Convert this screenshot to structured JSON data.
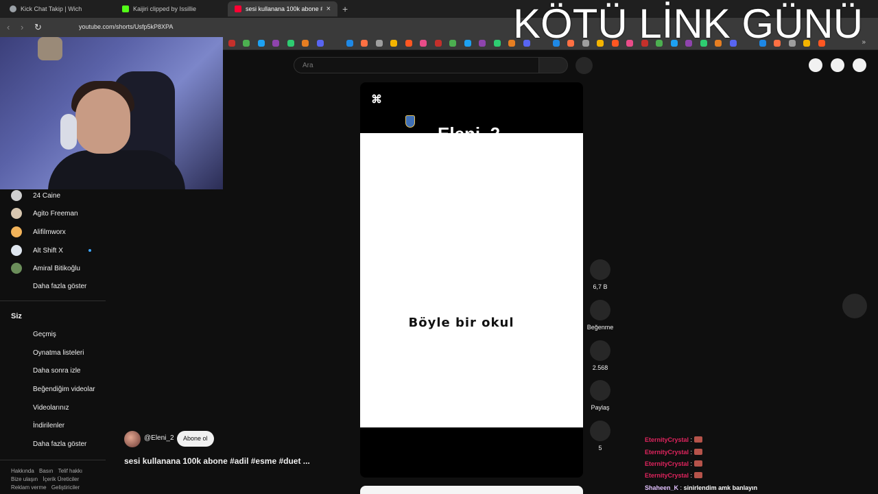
{
  "browser": {
    "tabs": [
      {
        "label": "Kick Chat Takip | Wich",
        "favicon_color": "#9aa0a6"
      },
      {
        "label": "Kaijiri clipped by Issillie",
        "favicon_color": "#53fc18"
      },
      {
        "label": "sesi kullanana 100k abone #adil",
        "favicon_color": "#ff0033"
      }
    ],
    "new_tab": "+",
    "close": "×",
    "url": "youtube.com/shorts/Usfp5kP8XPA",
    "back": "‹",
    "forward": "›",
    "reload": "↻",
    "bookmarks_more": "»"
  },
  "overlay": {
    "title": "KÖTÜ LİNK GÜNÜ"
  },
  "search": {
    "placeholder": "Ara"
  },
  "sidebar": {
    "subscriptions": [
      {
        "name": "24 Caine",
        "avatar_color": "#cfcfcf"
      },
      {
        "name": "Agito Freeman",
        "avatar_color": "#d8c7b0"
      },
      {
        "name": "Alifilmworx",
        "avatar_color": "#f2b35a"
      },
      {
        "name": "Alt Shift X",
        "avatar_color": "#dfe6ef",
        "new": true
      },
      {
        "name": "Amiral Bitikoğlu",
        "avatar_color": "#6b8e5a"
      }
    ],
    "subs_more": "Daha fazla göster",
    "you_heading": "Siz",
    "you_items": [
      "Geçmiş",
      "Oynatma listeleri",
      "Daha sonra izle",
      "Beğendiğim videolar",
      "Videolarınız",
      "İndirilenler",
      "Daha fazla göster"
    ],
    "footer": [
      [
        "Hakkında",
        "Basın",
        "Telif hakkı"
      ],
      [
        "Bize ulaşın",
        "İçerik Üreticiler"
      ],
      [
        "Reklam verme",
        "Geliştiriciler"
      ]
    ]
  },
  "short": {
    "watermark": "Eleni_2",
    "caption": "Böyle bir okul"
  },
  "actions": {
    "like_count": "6,7 B",
    "dislike_label": "Beğenme",
    "comments_count": "2.568",
    "share_label": "Paylaş",
    "remix_count": "5"
  },
  "channel": {
    "handle": "@Eleni_2",
    "subscribe": "Abone ol",
    "title": "sesi kullanana 100k abone #adil #esme #duet ..."
  },
  "chat": [
    {
      "user": "EternityCrystal",
      "sep": ":",
      "color": "#e0245e",
      "emote": true,
      "text": ""
    },
    {
      "user": "EternityCrystal",
      "sep": ":",
      "color": "#e0245e",
      "emote": true,
      "text": ""
    },
    {
      "user": "EternityCrystal",
      "sep": ":",
      "color": "#e0245e",
      "emote": true,
      "text": ""
    },
    {
      "user": "EternityCrystal",
      "sep": ":",
      "color": "#e0245e",
      "emote": true,
      "text": ""
    },
    {
      "user": "Shaheen_K",
      "sep": ":",
      "color": "#e3c2ff",
      "emote": false,
      "text": "sinirlendim amk banlayın"
    }
  ]
}
